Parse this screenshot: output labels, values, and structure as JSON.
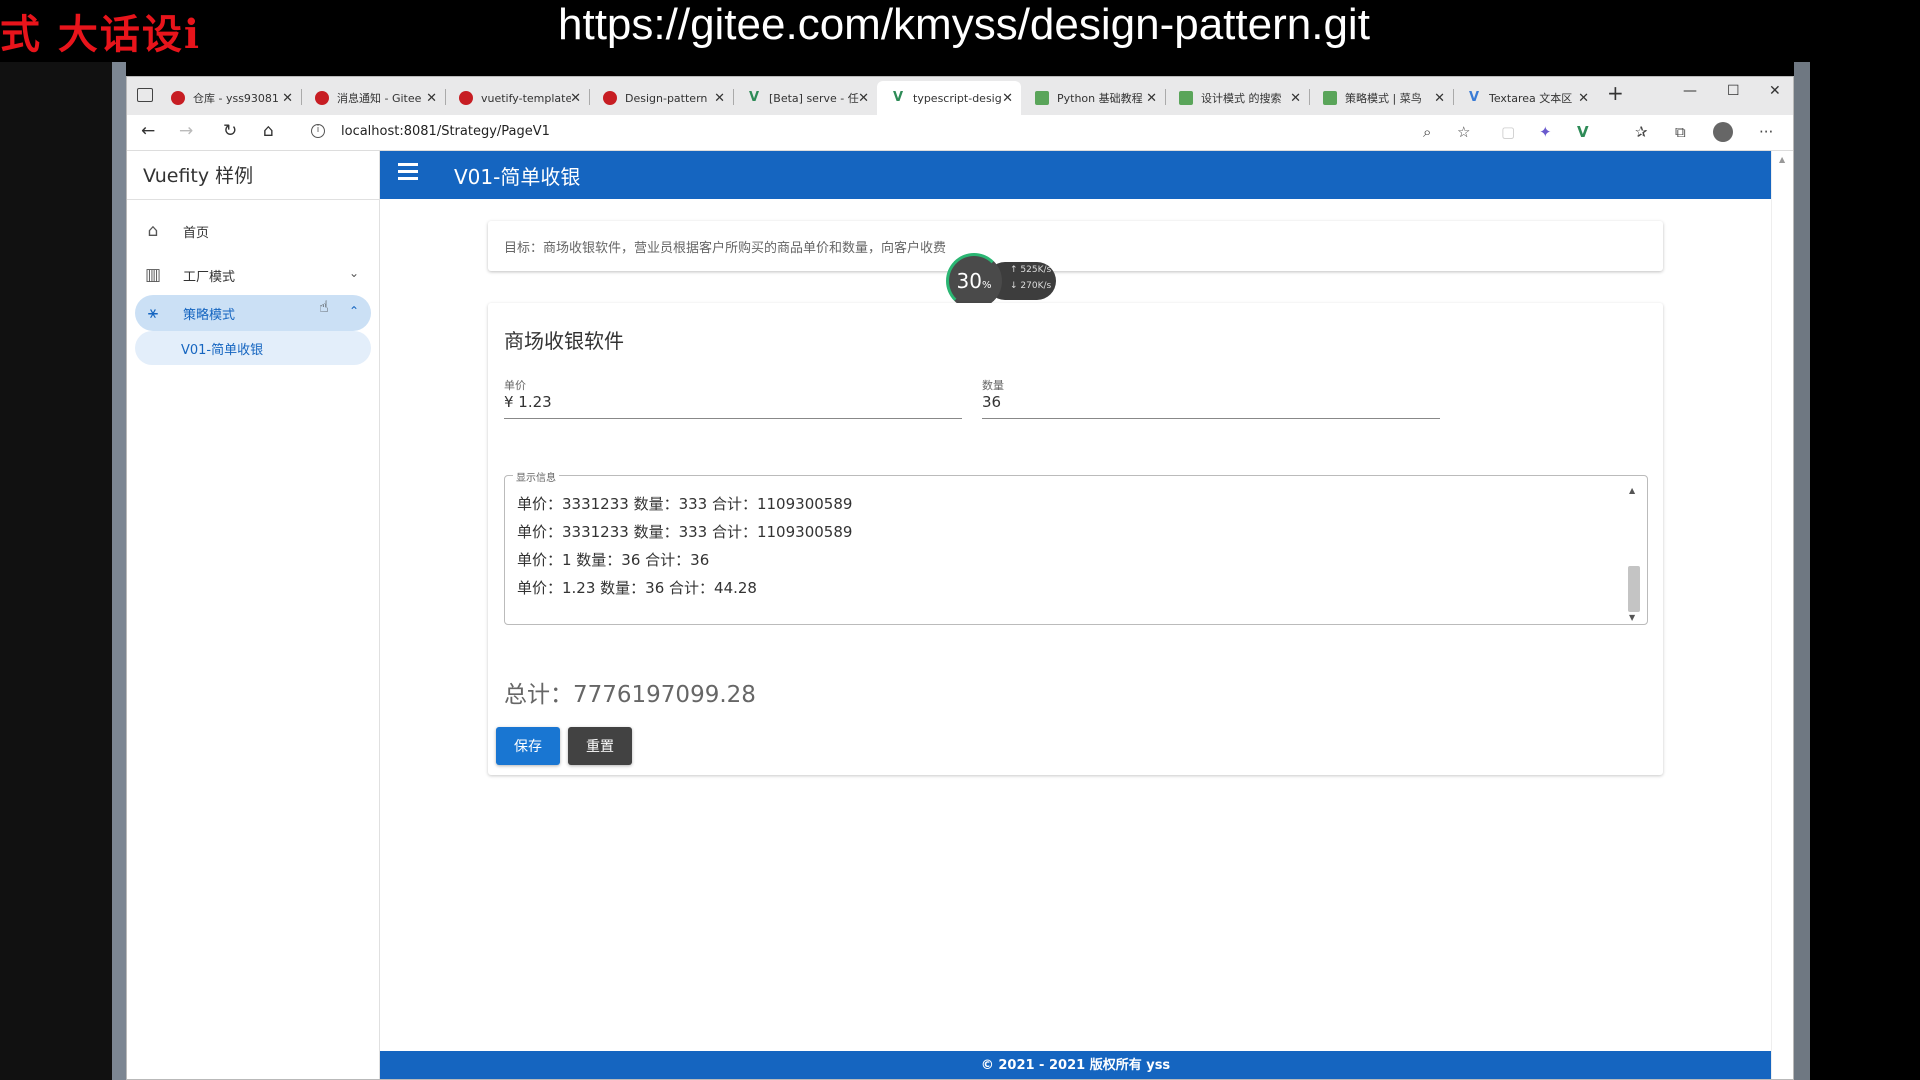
{
  "overlay": {
    "left_text": "式 大话设i",
    "url_text": "https://gitee.com/kmyss/design-pattern.git"
  },
  "browser": {
    "tabs": [
      {
        "title": "仓库 - yss93081",
        "icon": "gitee-icon"
      },
      {
        "title": "消息通知 - Gitee",
        "icon": "gitee-icon"
      },
      {
        "title": "vuetify-template",
        "icon": "gitee-icon"
      },
      {
        "title": "Design-pattern",
        "icon": "gitee-icon"
      },
      {
        "title": "[Beta] serve - 任",
        "icon": "vue-icon"
      },
      {
        "title": "typescript-desig",
        "icon": "vue-icon",
        "active": true
      },
      {
        "title": "Python 基础教程",
        "icon": "doc-icon"
      },
      {
        "title": "设计模式 的搜索",
        "icon": "doc-icon"
      },
      {
        "title": "策略模式 | 菜鸟",
        "icon": "doc-icon"
      },
      {
        "title": "Textarea 文本区",
        "icon": "vue-icon"
      }
    ],
    "address": "localhost:8081/Strategy/PageV1"
  },
  "sidebar": {
    "title": "Vuefity 样例",
    "items": [
      {
        "label": "首页",
        "icon": "home-icon"
      },
      {
        "label": "工厂模式",
        "icon": "factory-icon"
      },
      {
        "label": "策略模式",
        "icon": "strategy-icon"
      }
    ],
    "sub_item": "V01-简单收银"
  },
  "appbar": {
    "title": "V01-简单收银"
  },
  "goal": "目标：商场收银软件，营业员根据客户所购买的商品单价和数量，向客户收费",
  "speed_widget": {
    "percent": "30",
    "percent_unit": "%",
    "up": "525",
    "down": "270",
    "unit": "K/s"
  },
  "form": {
    "title": "商场收银软件",
    "price_label": "单价",
    "price_value": "¥ 1.23",
    "qty_label": "数量",
    "qty_value": "36",
    "log_label": "显示信息",
    "log_lines": [
      "单价：3331233 数量：333 合计：1109300589",
      "单价：3331233 数量：333 合计：1109300589",
      "单价：1 数量：36 合计：36",
      "单价：1.23 数量：36 合计：44.28"
    ],
    "total": "总计：7776197099.28",
    "save_label": "保存",
    "reset_label": "重置"
  },
  "footer": "© 2021 - 2021 版权所有 yss"
}
